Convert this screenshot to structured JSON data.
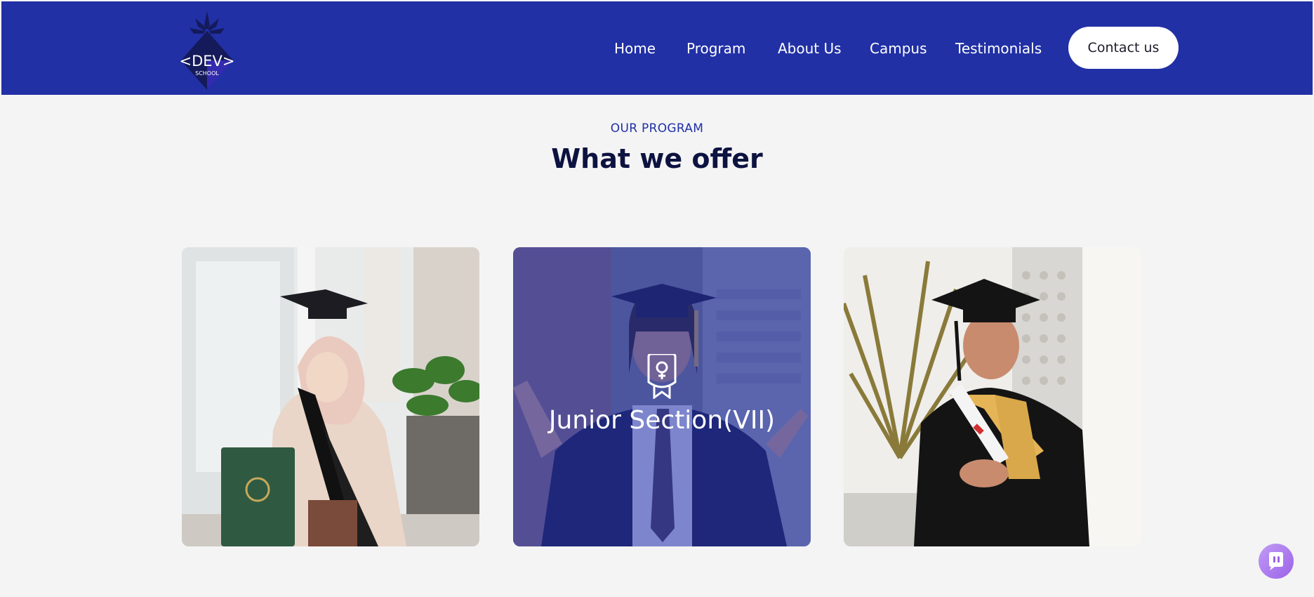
{
  "nav": {
    "logo_text": "<DEV>",
    "logo_sub": "SCHOOL",
    "items": [
      {
        "label": "Home"
      },
      {
        "label": "Program"
      },
      {
        "label": "About Us"
      },
      {
        "label": "Campus"
      },
      {
        "label": "Testimonials"
      }
    ],
    "cta_label": "Contact us"
  },
  "section": {
    "eyebrow": "OUR PROGRAM",
    "title": "What we offer"
  },
  "cards": [
    {
      "photo": "graduate-woman-hijab-with-plant",
      "title": ""
    },
    {
      "photo": "graduate-man-arms-open",
      "title": "Junior Section(VII)",
      "icon": "certificate-ribbon-icon"
    },
    {
      "photo": "graduate-man-holding-diploma",
      "title": ""
    }
  ],
  "chat": {
    "icon": "chat-bubble-icon"
  },
  "colors": {
    "brand_blue": "#2130a5",
    "page_bg": "#f4f4f5",
    "heading": "#0d1340",
    "chat_gradient_start": "#c19cf5",
    "chat_gradient_end": "#9c62e8"
  }
}
